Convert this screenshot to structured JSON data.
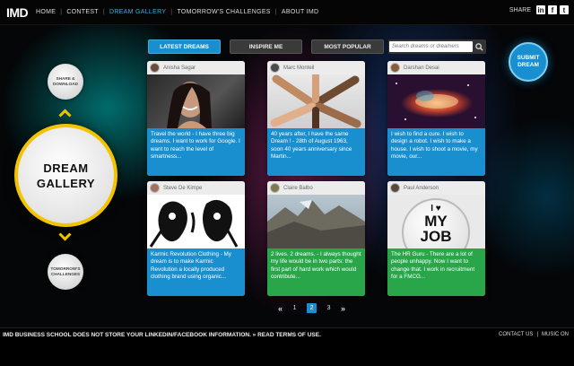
{
  "logo": "IMD",
  "nav": {
    "items": [
      {
        "label": "HOME",
        "active": false
      },
      {
        "label": "CONTEST",
        "active": false
      },
      {
        "label": "DREAM GALLERY",
        "active": true
      },
      {
        "label": "TOMORROW'S CHALLENGES",
        "active": false
      },
      {
        "label": "ABOUT IMD",
        "active": false
      }
    ]
  },
  "share": {
    "label": "SHARE",
    "icons": [
      "linkedin-icon",
      "facebook-icon",
      "twitter-icon"
    ],
    "glyphs": [
      "in",
      "f",
      "t"
    ]
  },
  "tabs": {
    "latest": "LATEST DREAMS",
    "inspire": "INSPIRE ME",
    "popular": "MOST POPULAR"
  },
  "search": {
    "placeholder": "Search dreams or dreamers"
  },
  "submit": {
    "line1": "SUBMIT",
    "line2": "DREAM"
  },
  "left": {
    "share_download": {
      "line1": "SHARE &",
      "line2": "DOWNLOAD"
    },
    "gallery": {
      "line1": "DREAM",
      "line2": "GALLERY"
    },
    "challenges": {
      "line1": "TOMORROW'S",
      "line2": "CHALLENGES"
    }
  },
  "cards": [
    {
      "name": "Anisha Sagar",
      "text": "Travel the world - I have three big dreams. I want to work for Google. I want to reach the level of smartness...",
      "color": "blue"
    },
    {
      "name": "Marc Monteil",
      "text": "40 years after, I have the same Dream ! - 28th of August 1963, soon 40 years anniversary since Martin...",
      "color": "blue"
    },
    {
      "name": "Darshan Desai",
      "text": "I wish to find a cure. I wish to design a robot. I wish to make a house. I wish to shoot a movie, my movie, our...",
      "color": "blue"
    },
    {
      "name": "Steve De Kimpe",
      "text": "Karmic Revolution Clothing - My dream is to make Karmic Revolution a locally produced clothing brand using organic...",
      "color": "blue"
    },
    {
      "name": "Claire Balbo",
      "text": "2 lives. 2 dreams. - I always thought my life would be in two parts: the first part of hard work which would contribute...",
      "color": "green"
    },
    {
      "name": "Paul Anderson",
      "text": "The HR Guru - There are a lot of people unhappy. Now I want to change that. I work in recruitment for a FMCG...",
      "color": "green"
    }
  ],
  "poster": {
    "heart": "I ♥",
    "my": "MY",
    "job": "JOB"
  },
  "pager": {
    "prev": "«",
    "pages": [
      "1",
      "2",
      "3"
    ],
    "current": "2",
    "next": "»"
  },
  "footer": {
    "note": "IMD BUSINESS SCHOOL DOES NOT STORE YOUR LINKEDIN/FACEBOOK INFORMATION. » READ TERMS OF USE.",
    "contact": "CONTACT US",
    "sep": "|",
    "music": "MUSIC ON"
  }
}
